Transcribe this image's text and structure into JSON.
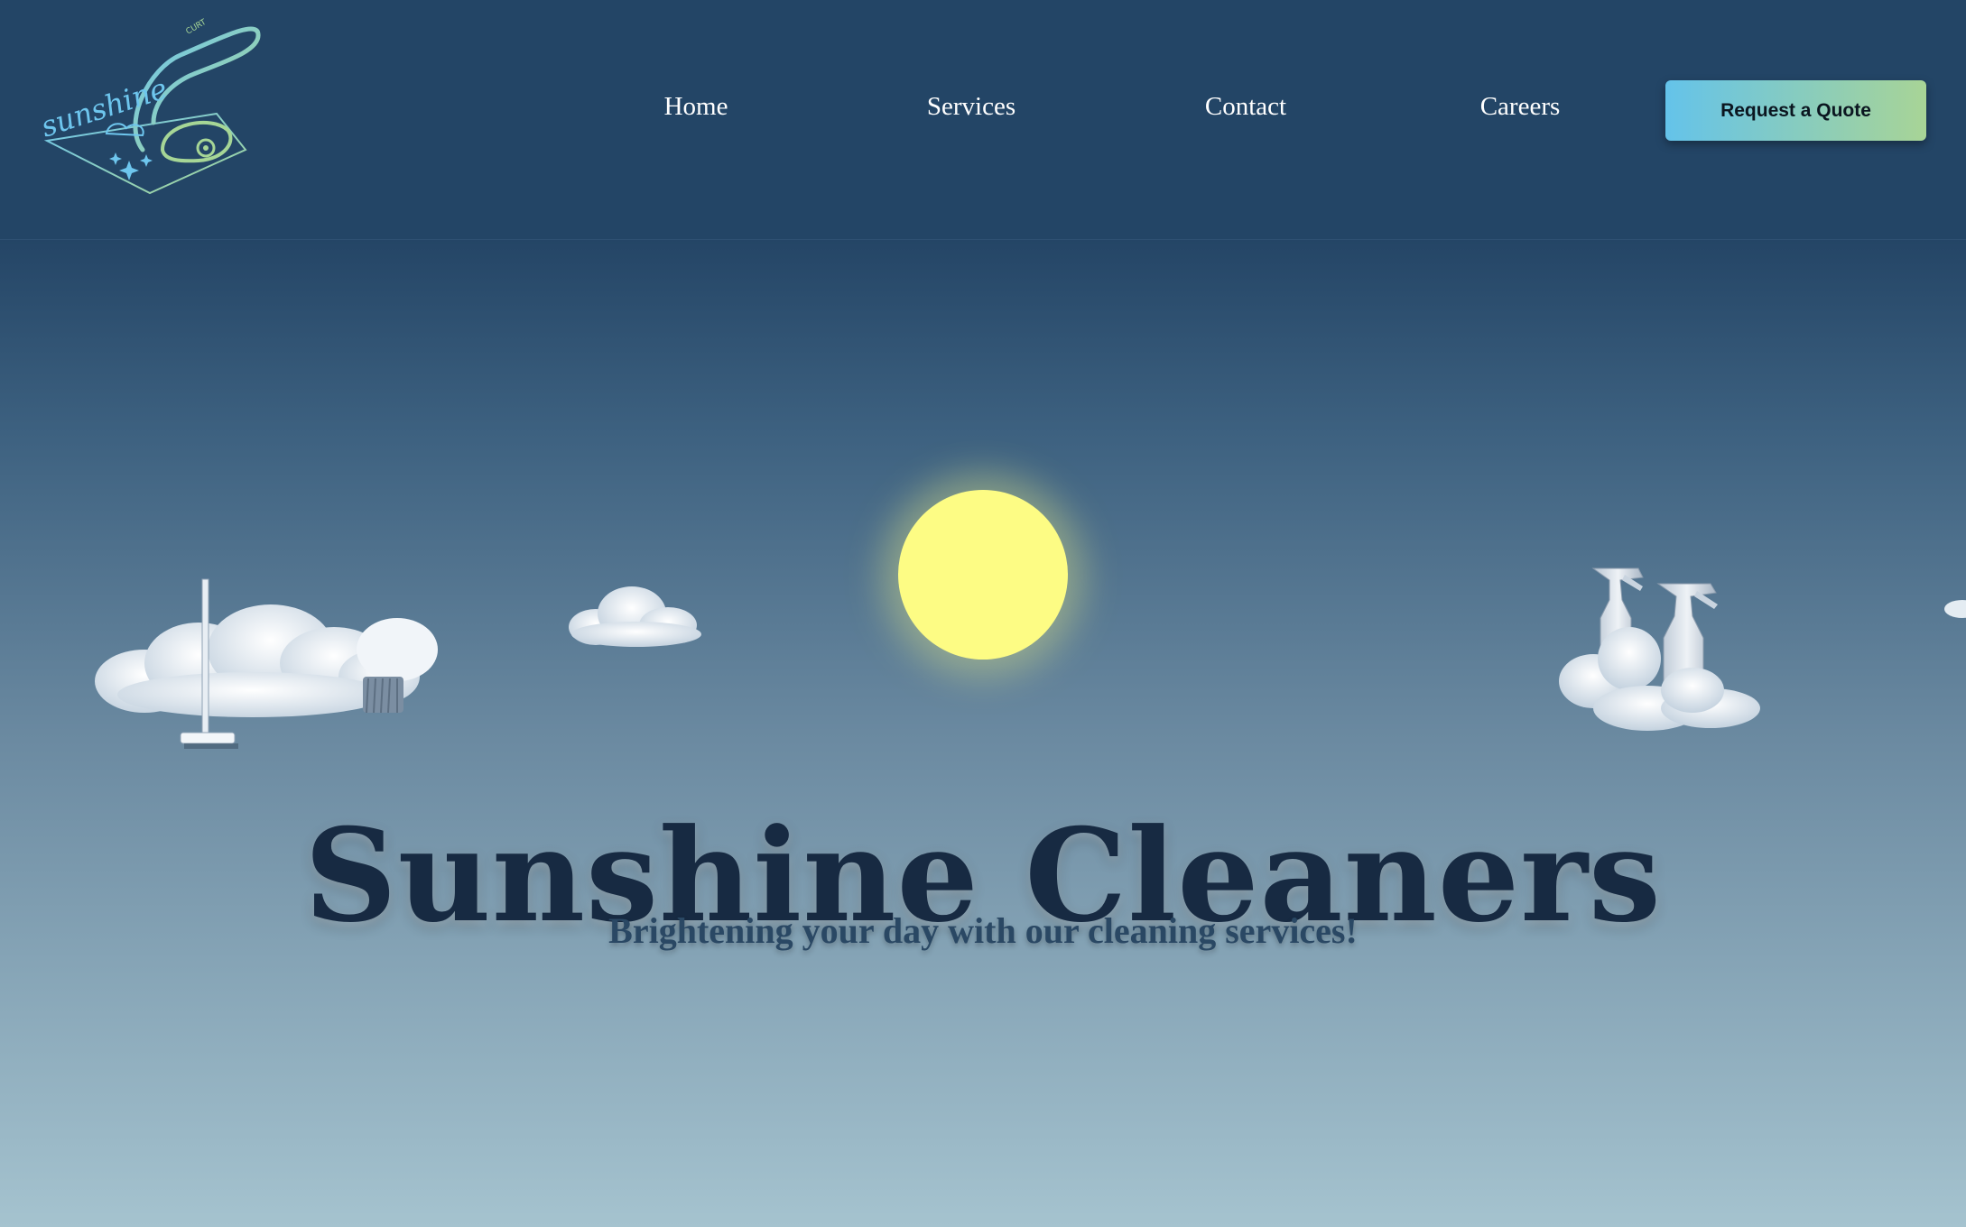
{
  "brand": {
    "logo_text": "sunshine",
    "logo_small_text": "CURT",
    "logo_icon": "vacuum-logo-icon"
  },
  "nav": {
    "items": [
      {
        "label": "Home"
      },
      {
        "label": "Services"
      },
      {
        "label": "Contact"
      },
      {
        "label": "Careers"
      }
    ],
    "cta_label": "Request a Quote"
  },
  "hero": {
    "title": "Sunshine Cleaners",
    "subtitle": "Brightening your day with our cleaning services!",
    "decorations": [
      "cloud-mop-icon",
      "cloud-icon",
      "sun-icon",
      "cloud-spray-bottles-icon"
    ]
  },
  "colors": {
    "header_bg": "#234566",
    "sun": "#fdfc84",
    "cta_gradient_start": "#64c3ea",
    "cta_gradient_end": "#a8d496",
    "title": "#172a42",
    "subtitle": "#2a4864"
  }
}
